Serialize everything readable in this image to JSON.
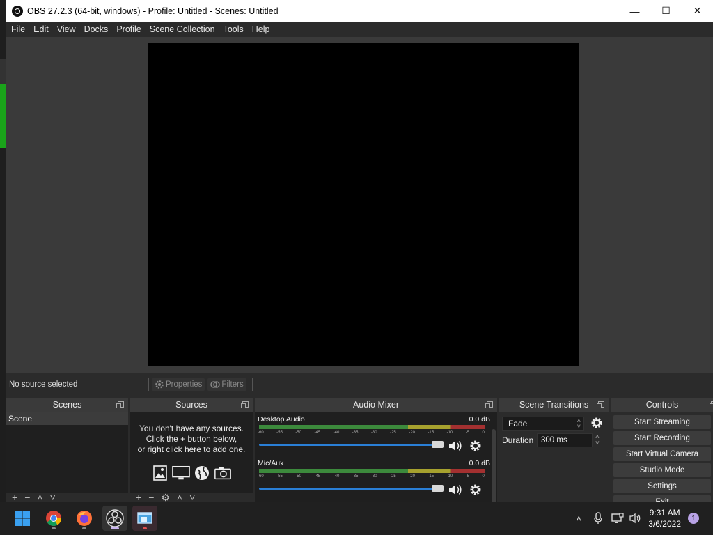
{
  "window": {
    "title": "OBS 27.2.3 (64-bit, windows) - Profile: Untitled - Scenes: Untitled"
  },
  "menu": [
    "File",
    "Edit",
    "View",
    "Docks",
    "Profile",
    "Scene Collection",
    "Tools",
    "Help"
  ],
  "source_toolbar": {
    "status": "No source selected",
    "properties_label": "Properties",
    "filters_label": "Filters"
  },
  "docks": {
    "scenes": {
      "title": "Scenes",
      "items": [
        "Scene"
      ]
    },
    "sources": {
      "title": "Sources",
      "empty_line1": "You don't have any sources.",
      "empty_line2": "Click the + button below,",
      "empty_line3": "or right click here to add one."
    },
    "mixer": {
      "title": "Audio Mixer",
      "scale": [
        "-60",
        "-55",
        "-50",
        "-45",
        "-40",
        "-35",
        "-30",
        "-25",
        "-20",
        "-15",
        "-10",
        "-5",
        "0"
      ],
      "channels": [
        {
          "name": "Desktop Audio",
          "level": "0.0 dB",
          "volume": 1.0
        },
        {
          "name": "Mic/Aux",
          "level": "0.0 dB",
          "volume": 1.0
        }
      ]
    },
    "transitions": {
      "title": "Scene Transitions",
      "selected": "Fade",
      "duration_label": "Duration",
      "duration_value": "300 ms"
    },
    "controls": {
      "title": "Controls",
      "buttons": [
        "Start Streaming",
        "Start Recording",
        "Start Virtual Camera",
        "Studio Mode",
        "Settings",
        "Exit"
      ]
    }
  },
  "taskbar": {
    "time": "9:31 AM",
    "date": "3/6/2022",
    "notifications": "1"
  },
  "colors": {
    "accent": "#2a7fd6",
    "meter_green": "#3c8a3c",
    "meter_yellow": "#a6a12e",
    "meter_red": "#a33030"
  }
}
